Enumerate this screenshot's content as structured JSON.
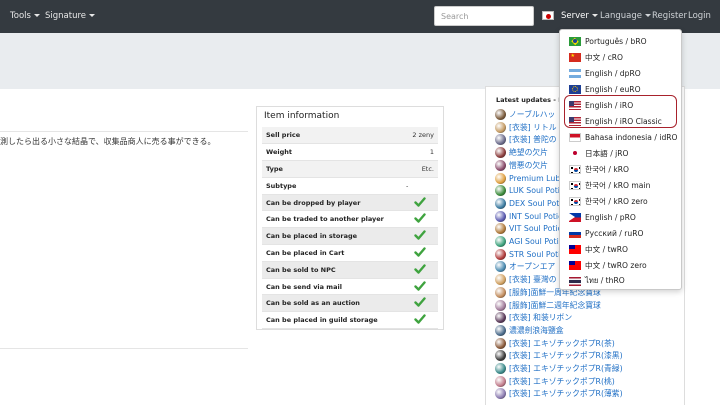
{
  "navbar": {
    "tools_label": "Tools",
    "signature_label": "Signature",
    "search_placeholder": "Search",
    "server_label": "Server",
    "language_label": "Language",
    "register_label": "Register",
    "login_label": "Login"
  },
  "item_description": "測したら出る小さな結晶で、収集品商人に売る事ができる。",
  "item_info": {
    "title": "Item information",
    "rows": [
      {
        "label": "Sell price",
        "value": "2 zeny"
      },
      {
        "label": "Weight",
        "value": "1"
      },
      {
        "label": "Type",
        "value": "Etc."
      },
      {
        "label": "Subtype",
        "value": "-"
      }
    ],
    "checks": [
      {
        "label": "Can be dropped by player",
        "value": true
      },
      {
        "label": "Can be traded to another player",
        "value": true
      },
      {
        "label": "Can be placed in storage",
        "value": true
      },
      {
        "label": "Can be placed in Cart",
        "value": true
      },
      {
        "label": "Can be sold to NPC",
        "value": true
      },
      {
        "label": "Can be send via mail",
        "value": true
      },
      {
        "label": "Can be sold as an auction",
        "value": true
      },
      {
        "label": "Can be placed in guild storage",
        "value": true
      }
    ]
  },
  "updates": {
    "title": "Latest updates - Ite",
    "items": [
      {
        "label": "ノーブルハッ",
        "icon_color": "#7a5a3a"
      },
      {
        "label": "[衣装] リトル",
        "icon_color": "#c49a62"
      },
      {
        "label": "[衣装] 普陀の",
        "icon_color": "#6a6a8a"
      },
      {
        "label": "絶望の欠片",
        "icon_color": "#8a3b3b"
      },
      {
        "label": "憎悪の欠片",
        "icon_color": "#8a4b6b"
      },
      {
        "label": "Premium Lubri",
        "icon_color": "#e0a040"
      },
      {
        "label": "LUK Soul Potio",
        "icon_color": "#3a8a3a"
      },
      {
        "label": "DEX Soul Potio",
        "icon_color": "#3a7aa0"
      },
      {
        "label": "INT Soul Potio",
        "icon_color": "#5a5ab0"
      },
      {
        "label": "VIT Soul Potio",
        "icon_color": "#b07a3a"
      },
      {
        "label": "AGI Soul Potio",
        "icon_color": "#3aa07a"
      },
      {
        "label": "STR Soul Potio",
        "icon_color": "#b03a3a"
      },
      {
        "label": "オープンエア",
        "icon_color": "#4a8ab0"
      },
      {
        "label": "[衣装] 臺灣の",
        "icon_color": "#d0a060"
      },
      {
        "label": "[服飾]面鮮一周年紀念寶球",
        "icon_color": "#c08a5a"
      },
      {
        "label": "[服飾]面鮮二週年紀念寶球",
        "icon_color": "#a07a9a"
      },
      {
        "label": "[衣装] 和装リボン",
        "icon_color": "#5a3a5a"
      },
      {
        "label": "濃濃劍浪海鹽盒",
        "icon_color": "#4a6a8a"
      },
      {
        "label": "[衣装] エキゾチックポプR(茶)",
        "icon_color": "#8a5a3a"
      },
      {
        "label": "[衣装] エキゾチックポプR(漆黒)",
        "icon_color": "#3a3a3a"
      },
      {
        "label": "[衣装] エキゾチックポプR(青緑)",
        "icon_color": "#3a8a8a"
      },
      {
        "label": "[衣装] エキゾチックポプR(桃)",
        "icon_color": "#c07a8a"
      },
      {
        "label": "[衣装] エキゾチックポプR(薄紫)",
        "icon_color": "#8a7ab0"
      }
    ]
  },
  "server_menu": {
    "items": [
      {
        "label": "Português / bRO",
        "flag": "br"
      },
      {
        "label": "中文 / cRO",
        "flag": "cn"
      },
      {
        "label": "English / dpRO",
        "flag": "ar"
      },
      {
        "label": "English / euRO",
        "flag": "eu"
      },
      {
        "label": "English / iRO",
        "flag": "us"
      },
      {
        "label": "English / iRO Classic",
        "flag": "us"
      },
      {
        "label": "Bahasa indonesia / idRO",
        "flag": "id"
      },
      {
        "label": "日本語 / jRO",
        "flag": "jp"
      },
      {
        "label": "한국어 / kRO",
        "flag": "kr"
      },
      {
        "label": "한국어 / kRO main",
        "flag": "kr"
      },
      {
        "label": "한국어 / kRO zero",
        "flag": "kr"
      },
      {
        "label": "English / pRO",
        "flag": "ph"
      },
      {
        "label": "Русский / ruRO",
        "flag": "ru"
      },
      {
        "label": "中文 / twRO",
        "flag": "tw"
      },
      {
        "label": "中文 / twRO zero",
        "flag": "tw"
      },
      {
        "label": "ไทย / thRO",
        "flag": "th"
      }
    ]
  },
  "colors": {
    "navbar": "#343a40",
    "band": "#e9ecef",
    "link": "#1f6fc5",
    "check": "#3fa33f",
    "highlight": "#a8222c"
  }
}
